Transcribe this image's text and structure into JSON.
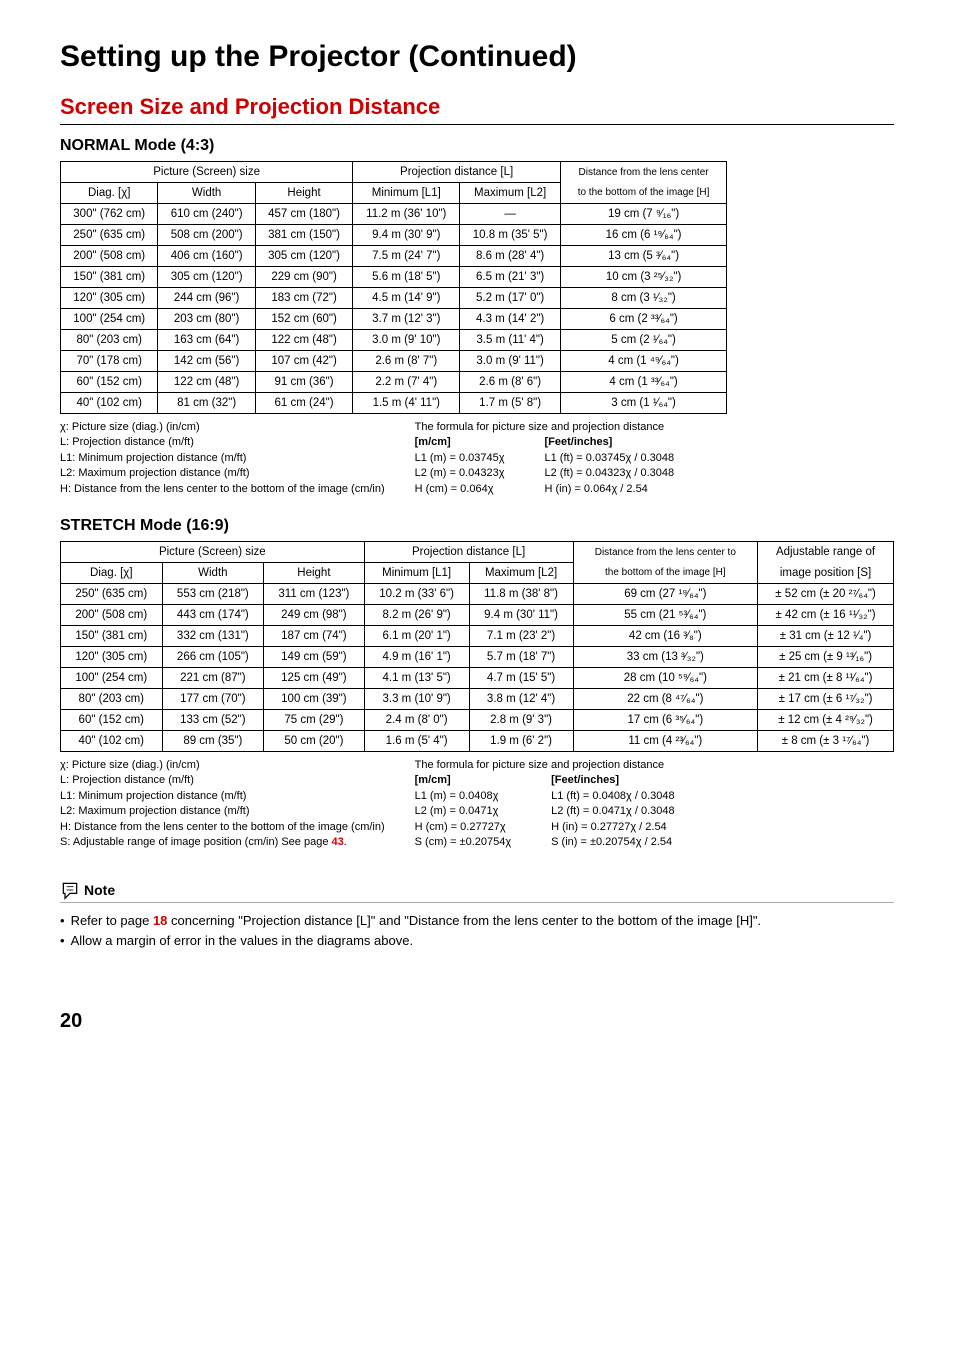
{
  "title": "Setting up the Projector (Continued)",
  "section": "Screen Size and Projection Distance",
  "mode1": "NORMAL Mode (4:3)",
  "mode2": "STRETCH Mode (16:9)",
  "headers1": {
    "pic": "Picture (Screen) size",
    "proj": "Projection distance [L]",
    "dist": "Distance from the lens center",
    "diag": "Diag. [χ]",
    "width": "Width",
    "height": "Height",
    "min": "Minimum [L1]",
    "max": "Maximum [L2]",
    "bottom": "to the bottom of the image [H]"
  },
  "headers2": {
    "pic": "Picture (Screen) size",
    "proj": "Projection distance [L]",
    "dist": "Distance from the lens center to",
    "range": "Adjustable range of",
    "diag": "Diag. [χ]",
    "width": "Width",
    "height": "Height",
    "min": "Minimum [L1]",
    "max": "Maximum [L2]",
    "bottom": "the bottom of the image [H]",
    "imgpos": "image position [S]"
  },
  "rows1": [
    [
      "300\" (762 cm)",
      "610 cm (240\")",
      "457 cm (180\")",
      "11.2 m (36' 10\")",
      "—",
      "19 cm (7 ⁹⁄₁₆\")"
    ],
    [
      "250\" (635 cm)",
      "508 cm (200\")",
      "381 cm (150\")",
      "9.4 m (30' 9\")",
      "10.8 m (35' 5\")",
      "16 cm (6 ¹⁹⁄₆₄\")"
    ],
    [
      "200\" (508 cm)",
      "406 cm (160\")",
      "305 cm (120\")",
      "7.5 m (24' 7\")",
      "8.6 m (28' 4\")",
      "13 cm (5 ³⁄₆₄\")"
    ],
    [
      "150\" (381 cm)",
      "305 cm (120\")",
      "229 cm (90\")",
      "5.6 m (18' 5\")",
      "6.5 m (21' 3\")",
      "10 cm (3 ²⁵⁄₃₂\")"
    ],
    [
      "120\" (305 cm)",
      "244 cm (96\")",
      "183 cm (72\")",
      "4.5 m (14' 9\")",
      "5.2 m (17' 0\")",
      "8 cm (3 ¹⁄₃₂\")"
    ],
    [
      "100\" (254 cm)",
      "203 cm (80\")",
      "152 cm (60\")",
      "3.7 m (12' 3\")",
      "4.3 m (14' 2\")",
      "6 cm (2 ³³⁄₆₄\")"
    ],
    [
      "80\" (203 cm)",
      "163 cm (64\")",
      "122 cm (48\")",
      "3.0 m (9' 10\")",
      "3.5 m (11' 4\")",
      "5 cm (2 ¹⁄₆₄\")"
    ],
    [
      "70\" (178 cm)",
      "142 cm (56\")",
      "107 cm (42\")",
      "2.6 m (8' 7\")",
      "3.0 m (9' 11\")",
      "4 cm (1 ⁴⁹⁄₆₄\")"
    ],
    [
      "60\" (152 cm)",
      "122 cm (48\")",
      "91 cm (36\")",
      "2.2 m (7' 4\")",
      "2.6 m (8' 6\")",
      "4 cm (1 ³³⁄₆₄\")"
    ],
    [
      "40\" (102 cm)",
      "81 cm (32\")",
      "61 cm (24\")",
      "1.5 m (4' 11\")",
      "1.7 m (5' 8\")",
      "3 cm (1 ¹⁄₆₄\")"
    ]
  ],
  "rows2": [
    [
      "250\" (635 cm)",
      "553 cm (218\")",
      "311 cm (123\")",
      "10.2 m (33' 6\")",
      "11.8 m (38' 8\")",
      "69 cm (27 ¹⁹⁄₆₄\")",
      "± 52 cm (± 20 ²⁷⁄₆₄\")"
    ],
    [
      "200\" (508 cm)",
      "443 cm (174\")",
      "249 cm (98\")",
      "8.2 m (26' 9\")",
      "9.4 m (30' 11\")",
      "55 cm (21 ⁵³⁄₆₄\")",
      "± 42 cm (± 16 ¹¹⁄₃₂\")"
    ],
    [
      "150\" (381 cm)",
      "332 cm (131\")",
      "187 cm (74\")",
      "6.1 m (20' 1\")",
      "7.1 m (23' 2\")",
      "42 cm (16 ³⁄₈\")",
      "± 31 cm (± 12 ¹⁄₄\")"
    ],
    [
      "120\" (305 cm)",
      "266 cm (105\")",
      "149 cm (59\")",
      "4.9 m (16' 1\")",
      "5.7 m (18' 7\")",
      "33 cm (13 ³⁄₃₂\")",
      "± 25 cm (± 9 ¹³⁄₁₆\")"
    ],
    [
      "100\" (254 cm)",
      "221 cm (87\")",
      "125 cm (49\")",
      "4.1 m (13' 5\")",
      "4.7 m (15' 5\")",
      "28 cm (10 ⁵⁹⁄₆₄\")",
      "± 21 cm (± 8 ¹¹⁄₆₄\")"
    ],
    [
      "80\" (203 cm)",
      "177 cm (70\")",
      "100 cm (39\")",
      "3.3 m (10' 9\")",
      "3.8 m (12' 4\")",
      "22 cm (8 ⁴⁷⁄₆₄\")",
      "± 17 cm (± 6 ¹⁷⁄₃₂\")"
    ],
    [
      "60\" (152 cm)",
      "133 cm (52\")",
      "75 cm (29\")",
      "2.4 m (8' 0\")",
      "2.8 m (9' 3\")",
      "17 cm (6 ³⁵⁄₆₄\")",
      "± 12 cm (± 4 ²⁹⁄₃₂\")"
    ],
    [
      "40\" (102 cm)",
      "89 cm (35\")",
      "50 cm (20\")",
      "1.6 m (5' 4\")",
      "1.9 m (6' 2\")",
      "11 cm (4 ²³⁄₆₄\")",
      "± 8 cm (± 3 ¹⁷⁄₆₄\")"
    ]
  ],
  "legend1": {
    "left": [
      "χ: Picture size (diag.) (in/cm)",
      "L: Projection distance (m/ft)",
      "L1: Minimum projection distance (m/ft)",
      "L2: Maximum projection distance (m/ft)",
      "H: Distance from the lens center to the bottom of the image (cm/in)"
    ],
    "right_title": "The formula for picture size and projection distance",
    "mcol_h": "[m/cm]",
    "fcol_h": "[Feet/inches]",
    "mcol": [
      "L1 (m) = 0.03745χ",
      "L2 (m) = 0.04323χ",
      "H (cm) = 0.064χ"
    ],
    "fcol": [
      "L1 (ft) = 0.03745χ / 0.3048",
      "L2 (ft) = 0.04323χ / 0.3048",
      "H (in) = 0.064χ / 2.54"
    ]
  },
  "legend2": {
    "left": [
      "χ: Picture size (diag.) (in/cm)",
      "L: Projection distance (m/ft)",
      "L1: Minimum projection distance (m/ft)",
      "L2: Maximum projection distance (m/ft)",
      "H: Distance from the lens center to the bottom of the image (cm/in)"
    ],
    "left_last_pre": "S: Adjustable range of image position (cm/in)   See page ",
    "left_last_link": "43",
    "left_last_post": ".",
    "right_title": "The formula for picture size and projection distance",
    "mcol_h": "[m/cm]",
    "fcol_h": "[Feet/inches]",
    "mcol": [
      "L1 (m) = 0.0408χ",
      "L2 (m) = 0.0471χ",
      "H (cm) = 0.27727χ",
      "S (cm) = ±0.20754χ"
    ],
    "fcol": [
      "L1 (ft) = 0.0408χ / 0.3048",
      "L2 (ft) = 0.0471χ / 0.3048",
      "H (in) = 0.27727χ / 2.54",
      "S (in) = ±0.20754χ / 2.54"
    ]
  },
  "note": {
    "label": "Note",
    "b1_pre": "Refer to page ",
    "b1_link": "18",
    "b1_post": " concerning \"Projection distance [L]\" and \"Distance from the lens center to the bottom of the image [H]\".",
    "b2": "Allow a margin of error in the values in the diagrams above."
  },
  "page_number": "20"
}
